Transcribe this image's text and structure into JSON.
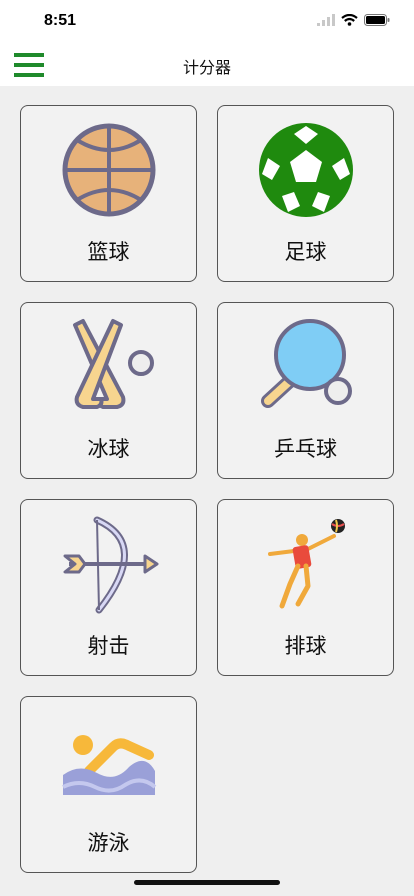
{
  "status_bar": {
    "time": "8:51"
  },
  "nav": {
    "title": "计分器",
    "menu_icon": "hamburger-menu-icon",
    "accent": "#1f8a2b"
  },
  "sports": [
    {
      "id": "basketball",
      "label": "篮球",
      "icon": "basketball-icon"
    },
    {
      "id": "football",
      "label": "足球",
      "icon": "soccer-ball-icon"
    },
    {
      "id": "ice-hockey",
      "label": "冰球",
      "icon": "hockey-sticks-icon"
    },
    {
      "id": "table-tennis",
      "label": "乒乓球",
      "icon": "ping-pong-paddle-icon"
    },
    {
      "id": "archery",
      "label": "射击",
      "icon": "bow-arrow-icon"
    },
    {
      "id": "volleyball",
      "label": "排球",
      "icon": "volleyball-player-icon"
    },
    {
      "id": "swimming",
      "label": "游泳",
      "icon": "swimmer-icon"
    }
  ]
}
